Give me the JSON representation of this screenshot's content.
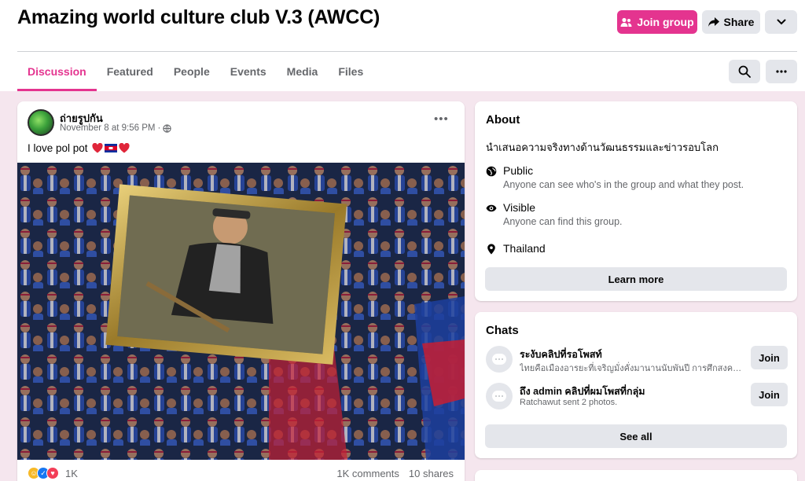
{
  "group": {
    "title": "Amazing world culture club V.3 (AWCC)",
    "join_label": "Join group",
    "share_label": "Share"
  },
  "tabs": [
    {
      "label": "Discussion",
      "active": true
    },
    {
      "label": "Featured"
    },
    {
      "label": "People"
    },
    {
      "label": "Events"
    },
    {
      "label": "Media"
    },
    {
      "label": "Files"
    }
  ],
  "post": {
    "author": "ถ่ายรูปกัน",
    "timestamp": "November 8 at 9:56 PM",
    "text": "I love pol pot",
    "reaction_count": "1K",
    "comments": "1K comments",
    "shares": "10 shares"
  },
  "about": {
    "heading": "About",
    "description": "นำเสนอความจริงทางด้านวัฒนธรรมและข่าวรอบโลก",
    "privacy_title": "Public",
    "privacy_desc": "Anyone can see who's in the group and what they post.",
    "visibility_title": "Visible",
    "visibility_desc": "Anyone can find this group.",
    "location": "Thailand",
    "learn_more": "Learn more"
  },
  "chats": {
    "heading": "Chats",
    "items": [
      {
        "title": "ระงับคลิปที่รอโพสท์",
        "subtitle": "ไทยคือเมืองอารยะที่เจริญมั่งคั่งมานานนับพันปี การศึกสงครา...",
        "join": "Join"
      },
      {
        "title": "ถึง admin คลิปที่ผมโพสที่กลุ่ม",
        "subtitle": "Ratchawut sent 2 photos.",
        "join": "Join"
      }
    ],
    "see_all": "See all"
  },
  "colors": {
    "accent": "#e4348f",
    "background": "#f5e6ee"
  }
}
